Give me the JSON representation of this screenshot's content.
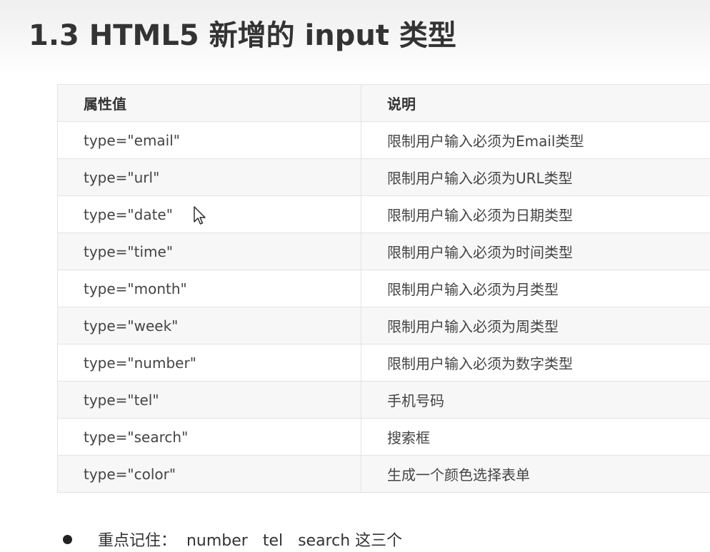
{
  "slide": {
    "title": "1.3 HTML5 新增的 input 类型"
  },
  "table": {
    "headers": [
      "属性值",
      "说明"
    ],
    "rows": [
      [
        "type=\"email\"",
        "限制用户输入必须为Email类型"
      ],
      [
        "type=\"url\"",
        "限制用户输入必须为URL类型"
      ],
      [
        "type=\"date\"",
        "限制用户输入必须为日期类型"
      ],
      [
        "type=\"time\"",
        "限制用户输入必须为时间类型"
      ],
      [
        "type=\"month\"",
        "限制用户输入必须为月类型"
      ],
      [
        "type=\"week\"",
        "限制用户输入必须为周类型"
      ],
      [
        "type=\"number\"",
        "限制用户输入必须为数字类型"
      ],
      [
        "type=\"tel\"",
        "手机号码"
      ],
      [
        "type=\"search\"",
        "搜索框"
      ],
      [
        "type=\"color\"",
        "生成一个颜色选择表单"
      ]
    ]
  },
  "note": {
    "text": "重点记住：  number   tel   search 这三个"
  },
  "icons": {
    "cursor": "mouse-pointer-icon",
    "bullet": "bullet-dot-icon"
  }
}
